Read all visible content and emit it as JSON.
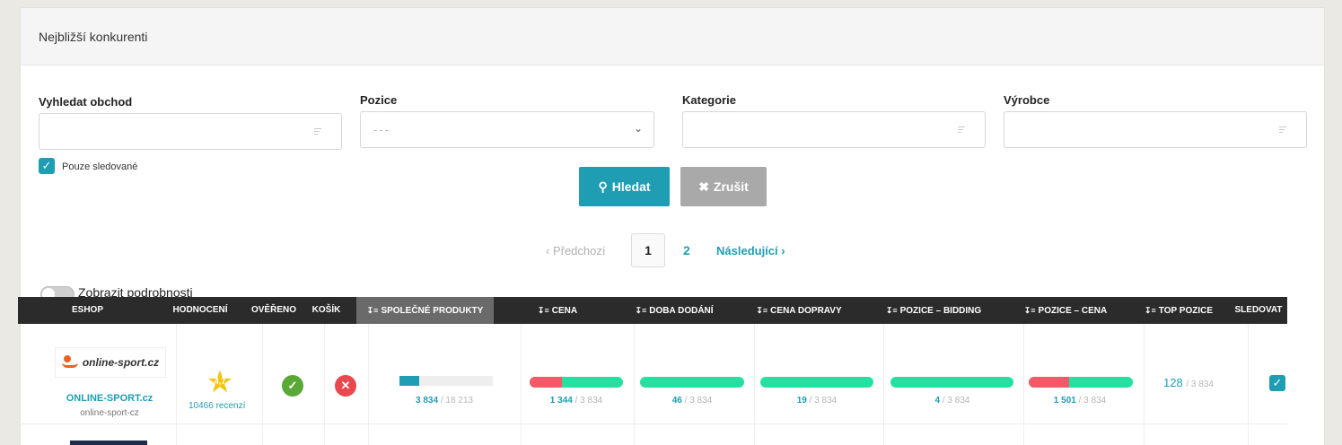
{
  "panel": {
    "title": "Nejbližší konkurenti"
  },
  "filters": {
    "search_shop": {
      "label": "Vyhledat obchod",
      "value": ""
    },
    "position": {
      "label": "Pozice",
      "placeholder": "---"
    },
    "category": {
      "label": "Kategorie",
      "value": ""
    },
    "manufacturer": {
      "label": "Výrobce",
      "value": ""
    },
    "only_watched": {
      "label": "Pouze sledované",
      "checked": true
    }
  },
  "buttons": {
    "search": "Hledat",
    "cancel": "Zrušit"
  },
  "pagination": {
    "prev": "Předchozí",
    "current": "1",
    "page2": "2",
    "next": "Následující"
  },
  "details_toggle": {
    "label": "Zobrazit podrobnosti",
    "on": false
  },
  "table": {
    "headers": [
      "ESHOP",
      "HODNOCENÍ",
      "OVĚŘENO",
      "KOŠÍK",
      "SPOLEČNÉ PRODUKTY",
      "CENA",
      "DOBA DODÁNÍ",
      "CENA DOPRAVY",
      "POZICE – BIDDING",
      "POZICE – CENA",
      "TOP POZICE",
      "SLEDOVAT"
    ],
    "rows": [
      {
        "eshop_name": "ONLINE-SPORT.cz",
        "eshop_slug": "online-sport-cz",
        "logo_text": "online-sport.cz",
        "rating": "4,7",
        "reviews": "10466 recenzí",
        "verified": true,
        "cart": false,
        "common_products": {
          "value": "3 834",
          "total": "/ 18 213",
          "fraction": 0.21
        },
        "price": {
          "value": "1 344",
          "total": "/ 3 834",
          "fraction": 0.35
        },
        "delivery_time": {
          "value": "46",
          "total": "/ 3 834",
          "fraction": 0.012
        },
        "shipping_price": {
          "value": "19",
          "total": "/ 3 834",
          "fraction": 0.005
        },
        "position_bidding": {
          "value": "4",
          "total": "/ 3 834",
          "fraction": 0.001
        },
        "position_price": {
          "value": "1 501",
          "total": "/ 3 834",
          "fraction": 0.39
        },
        "top_position": {
          "value": "128",
          "total": "/ 3 834"
        },
        "watched": true
      }
    ]
  },
  "colors": {
    "accent": "#1f9db3",
    "good": "#25e0a0",
    "bad": "#f25a68",
    "header_bg": "#2b2b2b"
  }
}
